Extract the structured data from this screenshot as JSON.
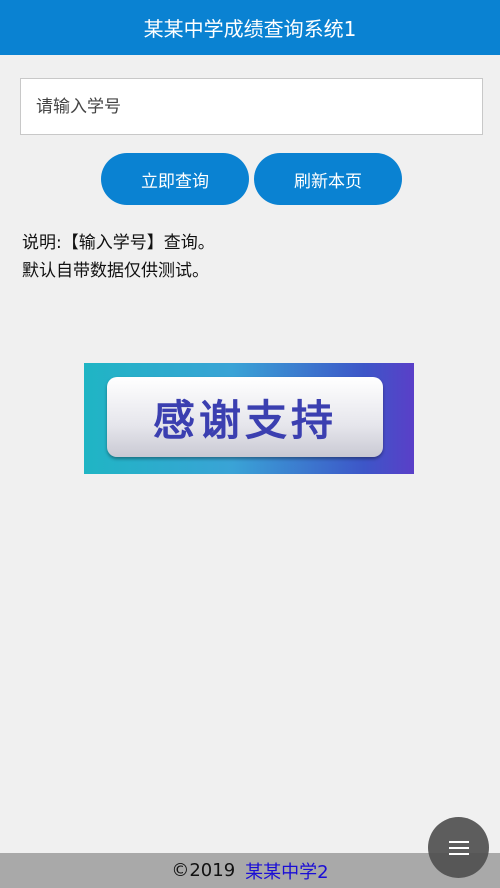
{
  "header": {
    "title": "某某中学成绩查询系统1"
  },
  "search": {
    "placeholder": "请输入学号",
    "value": ""
  },
  "buttons": {
    "query_label": "立即查询",
    "refresh_label": "刷新本页"
  },
  "description": {
    "line1": "说明:【输入学号】查询。",
    "line2": "默认自带数据仅供测试。"
  },
  "banner": {
    "text": "感谢支持"
  },
  "footer": {
    "copyright": "©2019",
    "link_label": "某某中学2"
  },
  "fab": {
    "icon": "menu-icon"
  },
  "colors": {
    "primary": "#0a82d2",
    "background": "#f0f0f0",
    "footer_bg": "#a9a9a9",
    "link": "#1a0dd6"
  }
}
